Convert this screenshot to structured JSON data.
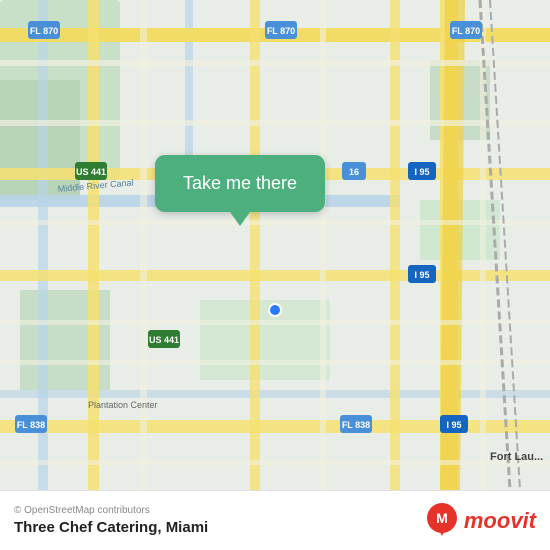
{
  "map": {
    "background_color": "#eaf0ea",
    "tooltip_bg": "#4caf7d",
    "tooltip_text": "Take me there"
  },
  "footer": {
    "copyright": "© OpenStreetMap contributors",
    "place_name": "Three Chef Catering, Miami",
    "moovit_label": "moovit",
    "moovit_color": "#e63329"
  }
}
